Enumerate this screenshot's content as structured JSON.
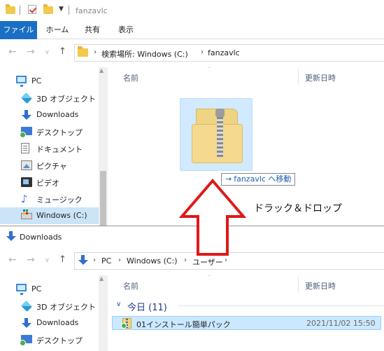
{
  "window1": {
    "title": "fanzavlc",
    "ribbon": {
      "file": "ファイル",
      "home": "ホーム",
      "share": "共有",
      "view": "表示"
    },
    "address": {
      "seg1": "検索場所: Windows (C:)",
      "seg2": "fanzavlc"
    },
    "nav": {
      "pc": "PC",
      "items": [
        "3D オブジェクト",
        "Downloads",
        "デスクトップ",
        "ドキュメント",
        "ピクチャ",
        "ビデオ",
        "ミュージック",
        "Windows (C:)"
      ]
    },
    "columns": {
      "name": "名前",
      "date": "更新日時"
    },
    "drag_tip": {
      "arrow": "→",
      "text": "fanzavlc へ移動"
    }
  },
  "annotation": "ドラック＆ドロップ",
  "window2": {
    "title": "Downloads",
    "address": {
      "seg1": "PC",
      "seg2": "Windows (C:)",
      "seg3": "ユーザー"
    },
    "nav": {
      "pc": "PC",
      "items": [
        "3D オブジェクト",
        "Downloads",
        "デスクトップ"
      ]
    },
    "columns": {
      "name": "名前",
      "date": "更新日時"
    },
    "group": {
      "label": "今日 (11)"
    },
    "file": {
      "name": "01インストール簡単パック",
      "date": "2021/11/02 15:50"
    }
  },
  "colors": {
    "accent": "#1a6fc4",
    "selection": "#cce8ff",
    "arrow": "#e01818"
  }
}
